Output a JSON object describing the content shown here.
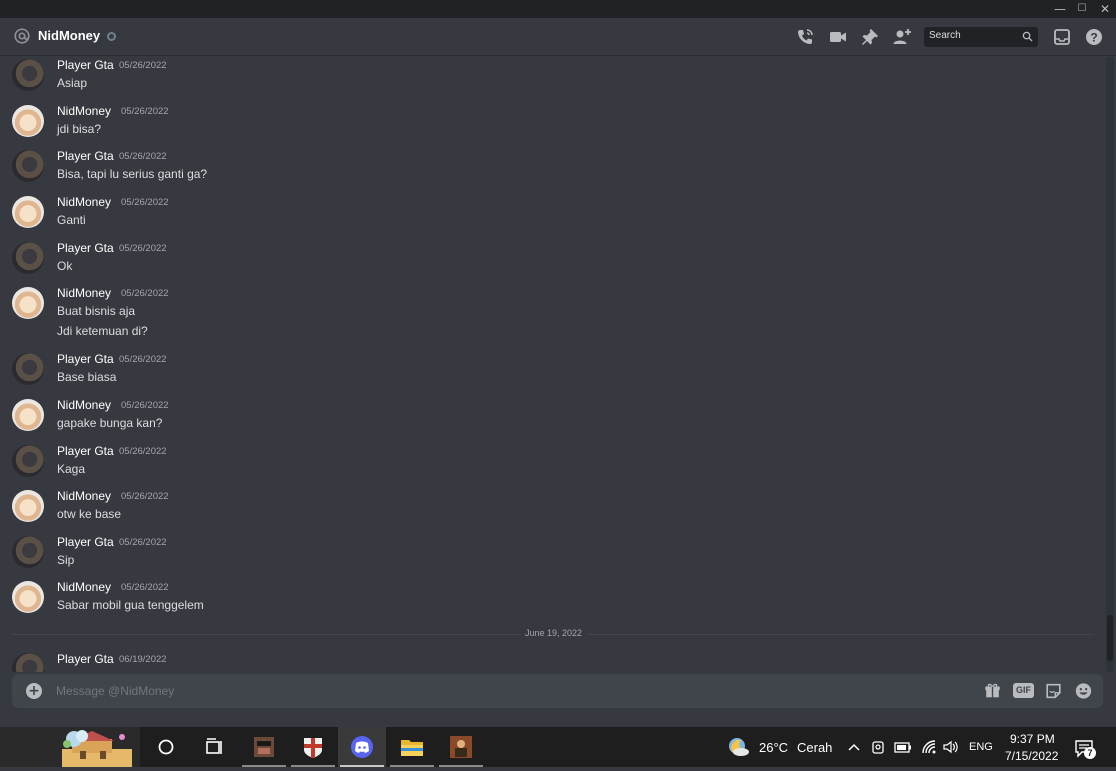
{
  "window": {
    "minimize": "—",
    "maximize": "☐",
    "close": "✕"
  },
  "header": {
    "channel_name": "NidMoney",
    "search_placeholder": "Search"
  },
  "messages": [
    {
      "user": "Player Gta",
      "avatar": "gta",
      "date": "05/26/2022",
      "lines": [
        "Asiap"
      ]
    },
    {
      "user": "NidMoney",
      "avatar": "cat",
      "date": "05/26/2022",
      "lines": [
        "jdi bisa?"
      ]
    },
    {
      "user": "Player Gta",
      "avatar": "gta",
      "date": "05/26/2022",
      "lines": [
        "Bisa, tapi lu serius ganti ga?"
      ]
    },
    {
      "user": "NidMoney",
      "avatar": "cat",
      "date": "05/26/2022",
      "lines": [
        "Ganti"
      ]
    },
    {
      "user": "Player Gta",
      "avatar": "gta",
      "date": "05/26/2022",
      "lines": [
        "Ok"
      ]
    },
    {
      "user": "NidMoney",
      "avatar": "cat",
      "date": "05/26/2022",
      "lines": [
        "Buat bisnis aja",
        "Jdi ketemuan di?"
      ]
    },
    {
      "user": "Player Gta",
      "avatar": "gta",
      "date": "05/26/2022",
      "lines": [
        "Base biasa"
      ]
    },
    {
      "user": "NidMoney",
      "avatar": "cat",
      "date": "05/26/2022",
      "lines": [
        "gapake bunga kan?"
      ]
    },
    {
      "user": "Player Gta",
      "avatar": "gta",
      "date": "05/26/2022",
      "lines": [
        "Kaga"
      ]
    },
    {
      "user": "NidMoney",
      "avatar": "cat",
      "date": "05/26/2022",
      "lines": [
        "otw ke base"
      ]
    },
    {
      "user": "Player Gta",
      "avatar": "gta",
      "date": "05/26/2022",
      "lines": [
        "Sip"
      ]
    },
    {
      "user": "NidMoney",
      "avatar": "cat",
      "date": "05/26/2022",
      "lines": [
        "Sabar mobil gua tenggelem"
      ]
    },
    {
      "user": "Player Gta",
      "avatar": "gta",
      "date": "06/19/2022",
      "lines": []
    }
  ],
  "divider_label": "June 19, 2022",
  "composer": {
    "placeholder": "Message @NidMoney",
    "gif_label": "GIF"
  },
  "taskbar": {
    "weather_temp": "26°C",
    "weather_desc": "Cerah",
    "language": "ENG",
    "time": "9:37 PM",
    "date": "7/15/2022",
    "notification_count": "7"
  },
  "icons": {
    "header": [
      "at-icon",
      "call-icon",
      "video-icon",
      "pin-icon",
      "add-friend-icon",
      "search-icon",
      "inbox-icon",
      "help-icon"
    ],
    "composer": [
      "plus-icon",
      "gift-icon",
      "gif-icon",
      "sticker-icon",
      "emoji-icon"
    ],
    "taskbar": [
      "start-icon",
      "cortana-icon",
      "task-view-icon",
      "game-app-icon",
      "shield-app-icon",
      "discord-icon",
      "file-explorer-icon",
      "game-app-2-icon",
      "weather-icon",
      "chevron-up-icon",
      "camera-icon",
      "battery-icon",
      "wifi-icon",
      "volume-icon",
      "notification-icon"
    ]
  }
}
